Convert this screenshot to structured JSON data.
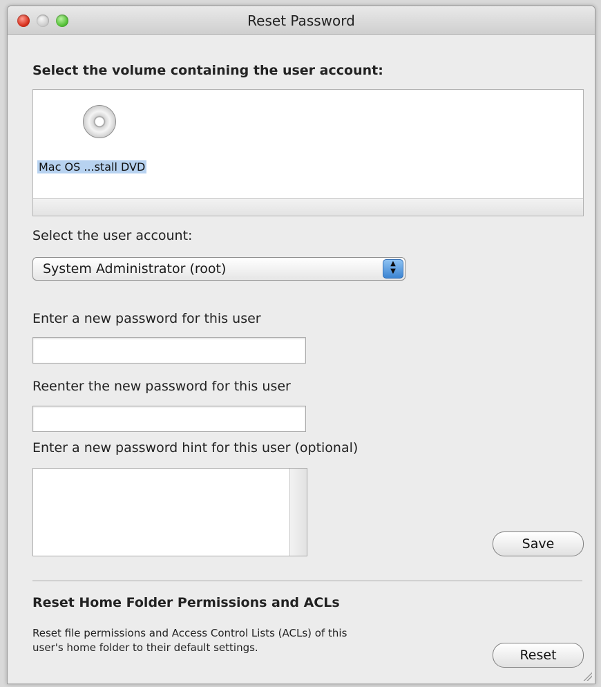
{
  "window": {
    "title": "Reset Password",
    "traffic_lights": [
      "close",
      "minimize",
      "zoom"
    ]
  },
  "volume_section": {
    "heading": "Select the volume containing the user account:",
    "volumes": [
      {
        "label": "Mac OS ...stall DVD",
        "icon": "dvd-disc-icon",
        "selected": true
      }
    ]
  },
  "user_section": {
    "label": "Select the user account:",
    "selected_user": "System Administrator (root)"
  },
  "password_section": {
    "new_password_label": "Enter a new password for this user",
    "new_password_value": "",
    "reenter_label": "Reenter the new password for this user",
    "reenter_value": "",
    "hint_label": "Enter a new password hint for this user (optional)",
    "hint_value": "",
    "save_button": "Save"
  },
  "permissions_section": {
    "heading": "Reset Home Folder Permissions and ACLs",
    "description_line1": "Reset file permissions and Access Control Lists (ACLs) of this",
    "description_line2": "user's home folder to their default settings.",
    "reset_button": "Reset"
  },
  "colors": {
    "window_bg": "#ececec",
    "selection_highlight": "#b7d2f0",
    "popup_arrow_blue": "#3b84d2",
    "close_red": "#d8321f",
    "zoom_green": "#57c23a"
  }
}
